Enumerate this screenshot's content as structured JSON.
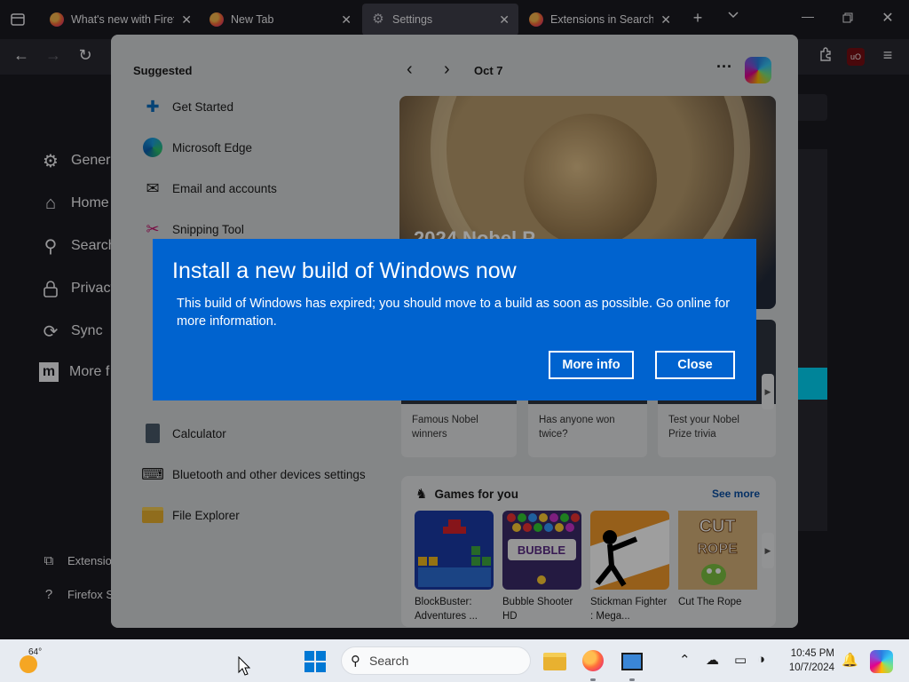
{
  "browser": {
    "tabs": [
      {
        "label": "What's new with Firefo",
        "icon": "firefox-icon"
      },
      {
        "label": "New Tab",
        "icon": "firefox-icon"
      },
      {
        "label": "Settings",
        "icon": "gear-icon",
        "active": true
      },
      {
        "label": "Extensions in Search Ta",
        "icon": "firefox-icon"
      }
    ],
    "close_glyph": "✕"
  },
  "settings": {
    "categories": [
      "General",
      "Home",
      "Search",
      "Privacy",
      "Sync",
      "More f"
    ],
    "footer": [
      "Extensio",
      "Firefox S"
    ]
  },
  "flyout": {
    "suggested_title": "Suggested",
    "suggested": [
      "Get Started",
      "Microsoft Edge",
      "Email and accounts",
      "Snipping Tool",
      "Calculator",
      "Bluetooth and other devices settings",
      "File Explorer"
    ],
    "date": "Oct 7",
    "headline": "2024 Nobel P",
    "cards": [
      "Famous Nobel winners",
      "Has anyone won twice?",
      "Test your Nobel Prize trivia"
    ],
    "games_title": "Games for you",
    "see_more": "See more",
    "games": [
      {
        "name": "BlockBuster: Adventures ...",
        "color": "#1a3aa8"
      },
      {
        "name": "Bubble Shooter HD",
        "color": "#3a2a6a"
      },
      {
        "name": "Stickman Fighter : Mega...",
        "color": "#f39a2b"
      },
      {
        "name": "Cut The Rope",
        "color": "#c49a5a"
      }
    ]
  },
  "dialog": {
    "title": "Install a new build of Windows now",
    "body": "This build of Windows has expired; you should move to a build as soon as possible. Go online for more information.",
    "more_info": "More info",
    "close": "Close",
    "color": "#0063cf"
  },
  "taskbar": {
    "temperature": "64°",
    "search_placeholder": "Search",
    "time": "10:45 PM",
    "date": "10/7/2024"
  }
}
